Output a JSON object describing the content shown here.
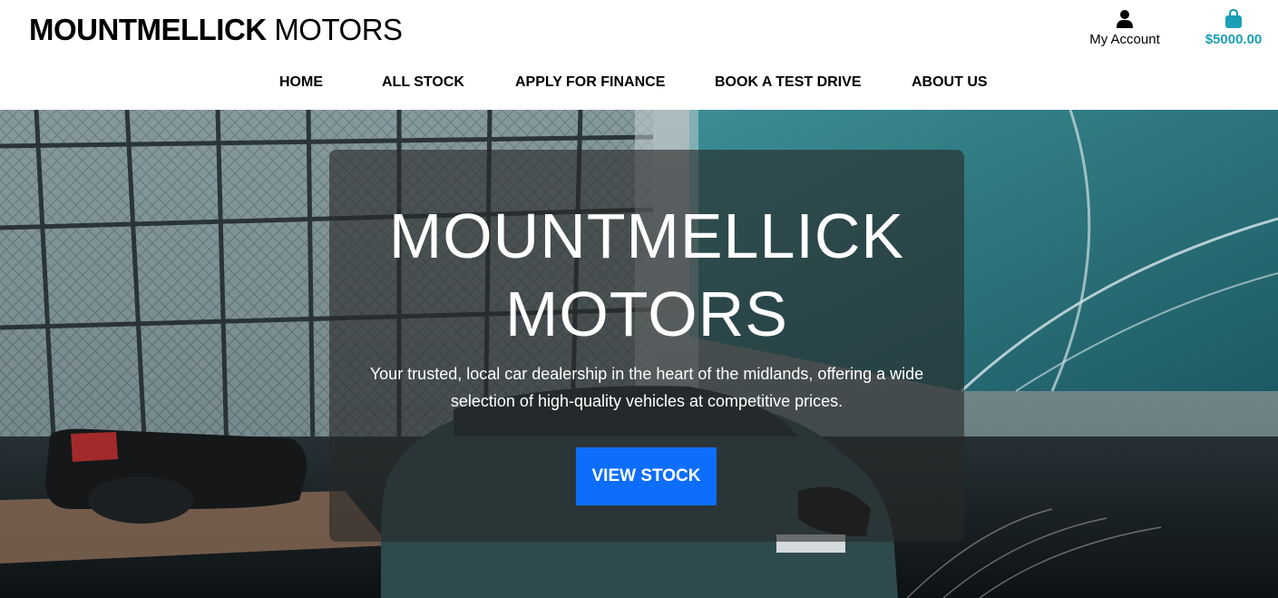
{
  "brand": {
    "name_bold": "MOUNTMELLICK",
    "name_light": "MOTORS"
  },
  "header": {
    "account_label": "My Account",
    "account_icon": "user-icon",
    "cart_total": "$5000.00",
    "cart_icon": "shopping-bag-icon"
  },
  "nav": {
    "items": [
      "HOME",
      "ALL STOCK",
      "APPLY FOR FINANCE",
      "BOOK A TEST DRIVE",
      "ABOUT US"
    ]
  },
  "hero": {
    "title_line1": "MOUNTMELLICK",
    "title_line2": "MOTORS",
    "subtitle": "Your trusted, local car dealership in the heart of the midlands, offering a wide selection of high-quality vehicles at competitive prices.",
    "cta_label": "VIEW STOCK"
  },
  "colors": {
    "accent": "#1aa0b5",
    "cta": "#0d6efd"
  }
}
